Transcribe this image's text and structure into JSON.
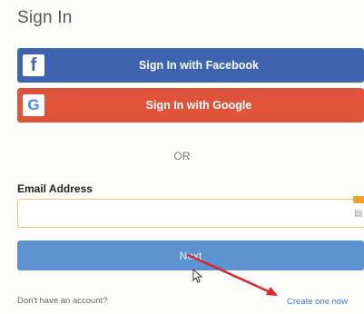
{
  "page": {
    "title": "Sign In"
  },
  "social": {
    "facebook_icon": "f",
    "facebook_label": "Sign In with Facebook",
    "google_icon": "G",
    "google_label": "Sign In with Google"
  },
  "divider": {
    "text": "OR"
  },
  "form": {
    "email_label": "Email Address",
    "email_value": "",
    "email_placeholder": "",
    "next_label": "Next"
  },
  "footer": {
    "no_account_text": "Don't have an account?",
    "create_link": "Create one now"
  },
  "colors": {
    "facebook": "#3e64b0",
    "google": "#e0533b",
    "next_button": "#5b92cf",
    "input_border": "#e8c46b",
    "link": "#3a7fc8",
    "annotation_arrow": "#d8262a"
  },
  "icons": {
    "facebook": "facebook-icon",
    "google": "google-icon",
    "cursor": "cursor-icon",
    "arrow": "annotation-arrow"
  }
}
